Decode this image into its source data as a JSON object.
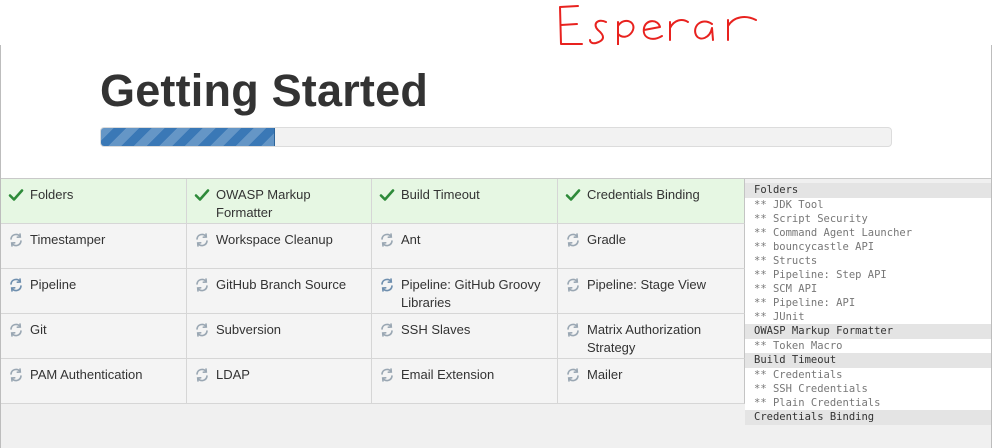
{
  "annotation": {
    "text": "Esperar",
    "color": "#e8221f"
  },
  "header": {
    "title": "Getting Started"
  },
  "progress": {
    "percent": 22,
    "fill_color": "#3a78b6"
  },
  "plugins": [
    {
      "label": "Folders",
      "status": "installed",
      "icon": "check-icon"
    },
    {
      "label": "OWASP Markup Formatter",
      "status": "installed",
      "icon": "check-icon"
    },
    {
      "label": "Build Timeout",
      "status": "installed",
      "icon": "check-icon"
    },
    {
      "label": "Credentials Binding",
      "status": "installed",
      "icon": "check-icon"
    },
    {
      "label": "Timestamper",
      "status": "pending",
      "icon": "refresh-icon"
    },
    {
      "label": "Workspace Cleanup",
      "status": "pending",
      "icon": "refresh-icon"
    },
    {
      "label": "Ant",
      "status": "pending",
      "icon": "refresh-icon"
    },
    {
      "label": "Gradle",
      "status": "pending",
      "icon": "refresh-icon"
    },
    {
      "label": "Pipeline",
      "status": "installing",
      "icon": "refresh-icon"
    },
    {
      "label": "GitHub Branch Source",
      "status": "pending",
      "icon": "refresh-icon"
    },
    {
      "label": "Pipeline: GitHub Groovy Libraries",
      "status": "installing",
      "icon": "refresh-icon"
    },
    {
      "label": "Pipeline: Stage View",
      "status": "pending",
      "icon": "refresh-icon"
    },
    {
      "label": "Git",
      "status": "pending",
      "icon": "refresh-icon"
    },
    {
      "label": "Subversion",
      "status": "pending",
      "icon": "refresh-icon"
    },
    {
      "label": "SSH Slaves",
      "status": "pending",
      "icon": "refresh-icon"
    },
    {
      "label": "Matrix Authorization Strategy",
      "status": "pending",
      "icon": "refresh-icon"
    },
    {
      "label": "PAM Authentication",
      "status": "pending",
      "icon": "refresh-icon"
    },
    {
      "label": "LDAP",
      "status": "pending",
      "icon": "refresh-icon"
    },
    {
      "label": "Email Extension",
      "status": "pending",
      "icon": "refresh-icon"
    },
    {
      "label": "Mailer",
      "status": "pending",
      "icon": "refresh-icon"
    }
  ],
  "log": [
    {
      "text": "Folders",
      "kind": "group"
    },
    {
      "text": "** JDK Tool",
      "kind": "dep"
    },
    {
      "text": "** Script Security",
      "kind": "dep"
    },
    {
      "text": "** Command Agent Launcher",
      "kind": "dep"
    },
    {
      "text": "** bouncycastle API",
      "kind": "dep"
    },
    {
      "text": "** Structs",
      "kind": "dep"
    },
    {
      "text": "** Pipeline: Step API",
      "kind": "dep"
    },
    {
      "text": "** SCM API",
      "kind": "dep"
    },
    {
      "text": "** Pipeline: API",
      "kind": "dep"
    },
    {
      "text": "** JUnit",
      "kind": "dep"
    },
    {
      "text": "OWASP Markup Formatter",
      "kind": "group"
    },
    {
      "text": "** Token Macro",
      "kind": "dep"
    },
    {
      "text": "Build Timeout",
      "kind": "group"
    },
    {
      "text": "** Credentials",
      "kind": "dep"
    },
    {
      "text": "** SSH Credentials",
      "kind": "dep"
    },
    {
      "text": "** Plain Credentials",
      "kind": "dep"
    },
    {
      "text": "Credentials Binding",
      "kind": "group"
    }
  ],
  "colors": {
    "installed_bg": "#e6f7e3",
    "pending_bg": "#f4f4f4",
    "check": "#2e8b3a",
    "spinner": "#9aa7b3",
    "spinner_active": "#6f8fae"
  }
}
